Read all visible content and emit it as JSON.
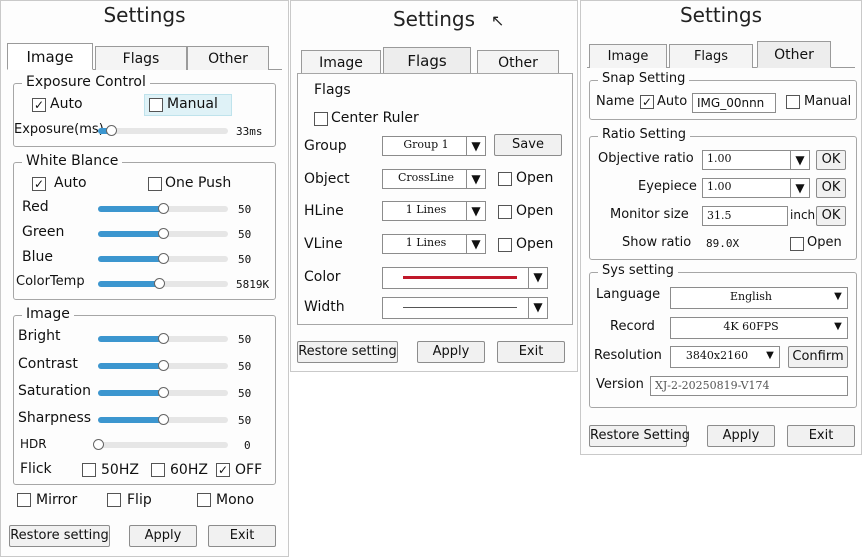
{
  "panel1": {
    "title": "Settings",
    "tabs": [
      "Image",
      "Flags",
      "Other"
    ],
    "exposure": {
      "legend": "Exposure Control",
      "auto_label": "Auto",
      "auto_checked": "✓",
      "manual_label": "Manual",
      "exposure_label": "Exposure(ms)",
      "exposure_value": "33ms",
      "exposure_level": 0.1
    },
    "white": {
      "legend": "White Blance",
      "auto_label": "Auto",
      "auto_checked": "✓",
      "onepush_label": "One Push",
      "red_label": "Red",
      "red_value": "50",
      "green_label": "Green",
      "green_value": "50",
      "blue_label": "Blue",
      "blue_value": "50",
      "colortemp_label": "ColorTemp",
      "colortemp_value": "5819K",
      "level_half": 0.5,
      "colortemp_level": 0.47
    },
    "image": {
      "legend": "Image",
      "bright_label": "Bright",
      "bright_value": "50",
      "contrast_label": "Contrast",
      "contrast_value": "50",
      "saturation_label": "Saturation",
      "saturation_value": "50",
      "sharpness_label": "Sharpness",
      "sharpness_value": "50",
      "hdr_label": "HDR",
      "hdr_value": "0",
      "flick_label": "Flick",
      "hz50_label": "50HZ",
      "hz60_label": "60HZ",
      "off_label": "OFF",
      "off_checked": "✓"
    },
    "mirror_label": "Mirror",
    "flip_label": "Flip",
    "mono_label": "Mono",
    "buttons": {
      "restore": "Restore setting",
      "apply": "Apply",
      "exit": "Exit"
    }
  },
  "panel2": {
    "title": "Settings",
    "tabs": [
      "Image",
      "Flags",
      "Other"
    ],
    "flags_heading": "Flags",
    "center_ruler_label": "Center Ruler",
    "group_label": "Group",
    "group_value": "Group 1",
    "save_label": "Save",
    "object_label": "Object",
    "object_value": "CrossLine",
    "open_label": "Open",
    "hline_label": "HLine",
    "hline_value": "1 Lines",
    "vline_label": "VLine",
    "vline_value": "1 Lines",
    "color_label": "Color",
    "color_value": "#c0182a",
    "width_label": "Width",
    "buttons": {
      "restore": "Restore setting",
      "apply": "Apply",
      "exit": "Exit"
    }
  },
  "panel3": {
    "title": "Settings",
    "tabs": [
      "Image",
      "Flags",
      "Other"
    ],
    "snap": {
      "legend": "Snap Setting",
      "name_label": "Name",
      "auto_label": "Auto",
      "auto_checked": "✓",
      "name_value": "IMG_00nnn",
      "manual_label": "Manual"
    },
    "ratio": {
      "legend": "Ratio Setting",
      "objective_label": "Objective ratio",
      "objective_value": "1.00",
      "eyepiece_label": "Eyepiece",
      "eyepiece_value": "1.00",
      "ok_label": "OK",
      "monitor_label": "Monitor size",
      "monitor_value": "31.5",
      "inch_label": "inch",
      "show_label": "Show ratio",
      "show_value": "89.0X",
      "open_label": "Open"
    },
    "sys": {
      "legend": "Sys setting",
      "language_label": "Language",
      "language_value": "English",
      "record_label": "Record",
      "record_value": "4K 60FPS",
      "resolution_label": "Resolution",
      "resolution_value": "3840x2160",
      "confirm_label": "Confirm",
      "version_label": "Version",
      "version_value": "XJ-2-20250819-V174"
    },
    "buttons": {
      "restore": "Restore Setting",
      "apply": "Apply",
      "exit": "Exit"
    }
  }
}
